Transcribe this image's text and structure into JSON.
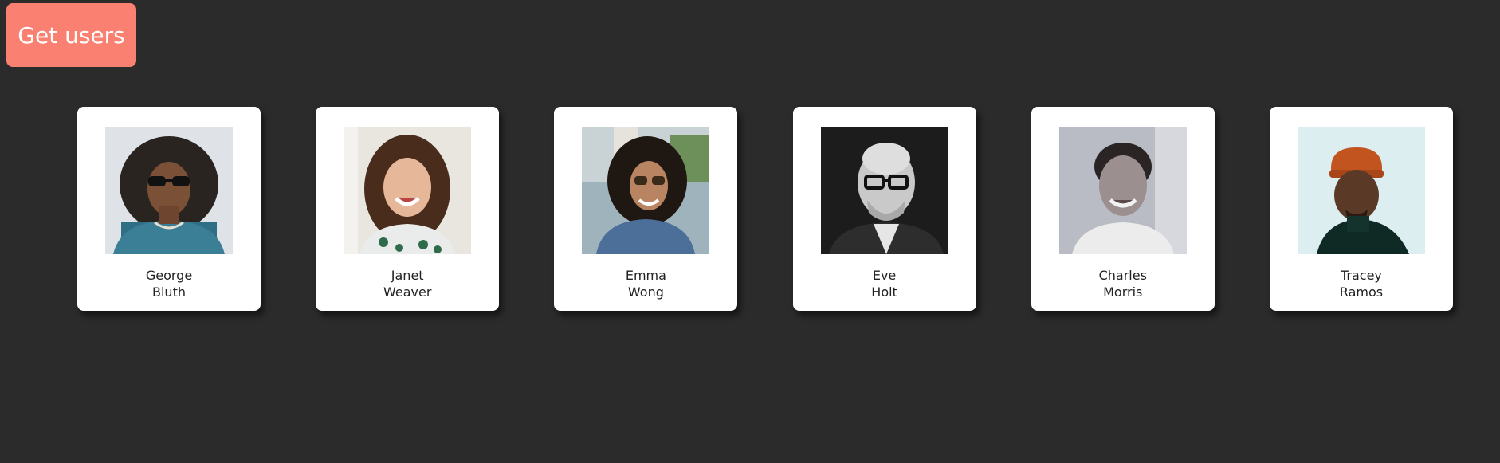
{
  "toolbar": {
    "get_users_label": "Get users"
  },
  "colors": {
    "background": "#2b2b2b",
    "button": "#fa8072",
    "card": "#ffffff"
  },
  "users": [
    {
      "first_name": "George",
      "last_name": "Bluth"
    },
    {
      "first_name": "Janet",
      "last_name": "Weaver"
    },
    {
      "first_name": "Emma",
      "last_name": "Wong"
    },
    {
      "first_name": "Eve",
      "last_name": "Holt"
    },
    {
      "first_name": "Charles",
      "last_name": "Morris"
    },
    {
      "first_name": "Tracey",
      "last_name": "Ramos"
    }
  ]
}
